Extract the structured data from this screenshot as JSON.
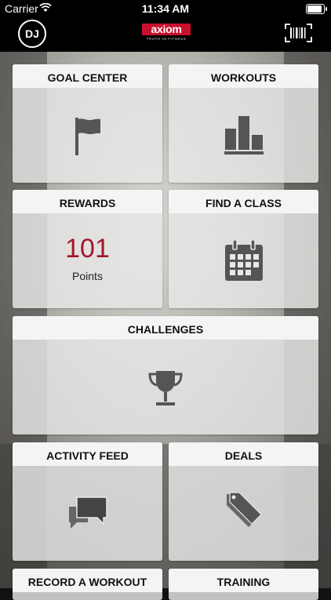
{
  "status_bar": {
    "carrier": "Carrier",
    "time": "11:34 AM",
    "battery_level": 1.0
  },
  "header": {
    "avatar_initials": "DJ",
    "logo_text": "axiom",
    "logo_tagline": "TRUTH IN FITNESS",
    "barcode_icon": "barcode-icon"
  },
  "tiles": {
    "goal_center": {
      "title": "GOAL CENTER",
      "icon": "flag-icon"
    },
    "workouts": {
      "title": "WORKOUTS",
      "icon": "bar-chart-icon"
    },
    "rewards": {
      "title": "REWARDS",
      "points_value": "101",
      "points_label": "Points"
    },
    "find_a_class": {
      "title": "FIND A CLASS",
      "icon": "calendar-icon"
    },
    "challenges": {
      "title": "CHALLENGES",
      "icon": "trophy-icon"
    },
    "activity_feed": {
      "title": "ACTIVITY FEED",
      "icon": "chat-bubbles-icon"
    },
    "deals": {
      "title": "DEALS",
      "icon": "price-tags-icon"
    },
    "record_a_workout": {
      "title": "RECORD A WORKOUT"
    },
    "training": {
      "title": "TRAINING"
    }
  },
  "colors": {
    "brand_red": "#c8102e",
    "points_red": "#a3162b",
    "icon_gray": "#555555"
  }
}
